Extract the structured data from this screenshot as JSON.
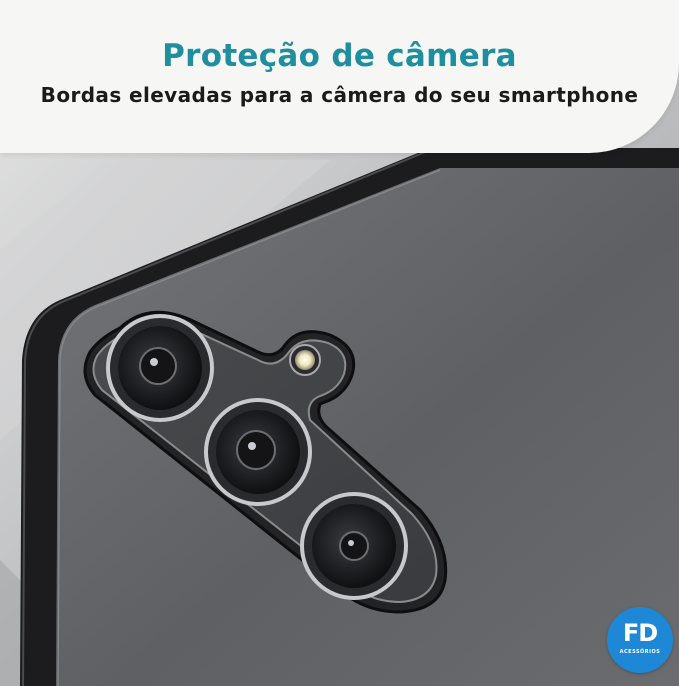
{
  "banner": {
    "title": "Proteção de câmera",
    "subtitle": "Bordas elevadas para a câmera do seu smartphone"
  },
  "logo": {
    "mark": "FD",
    "sub": "ACESSÓRIOS"
  },
  "colors": {
    "accent": "#1f8fa0",
    "logo": "#1e88d6",
    "case_frame": "#1c1c1e",
    "back_panel": "#5f6165"
  },
  "image": {
    "lenses": 3,
    "flash": 1
  }
}
